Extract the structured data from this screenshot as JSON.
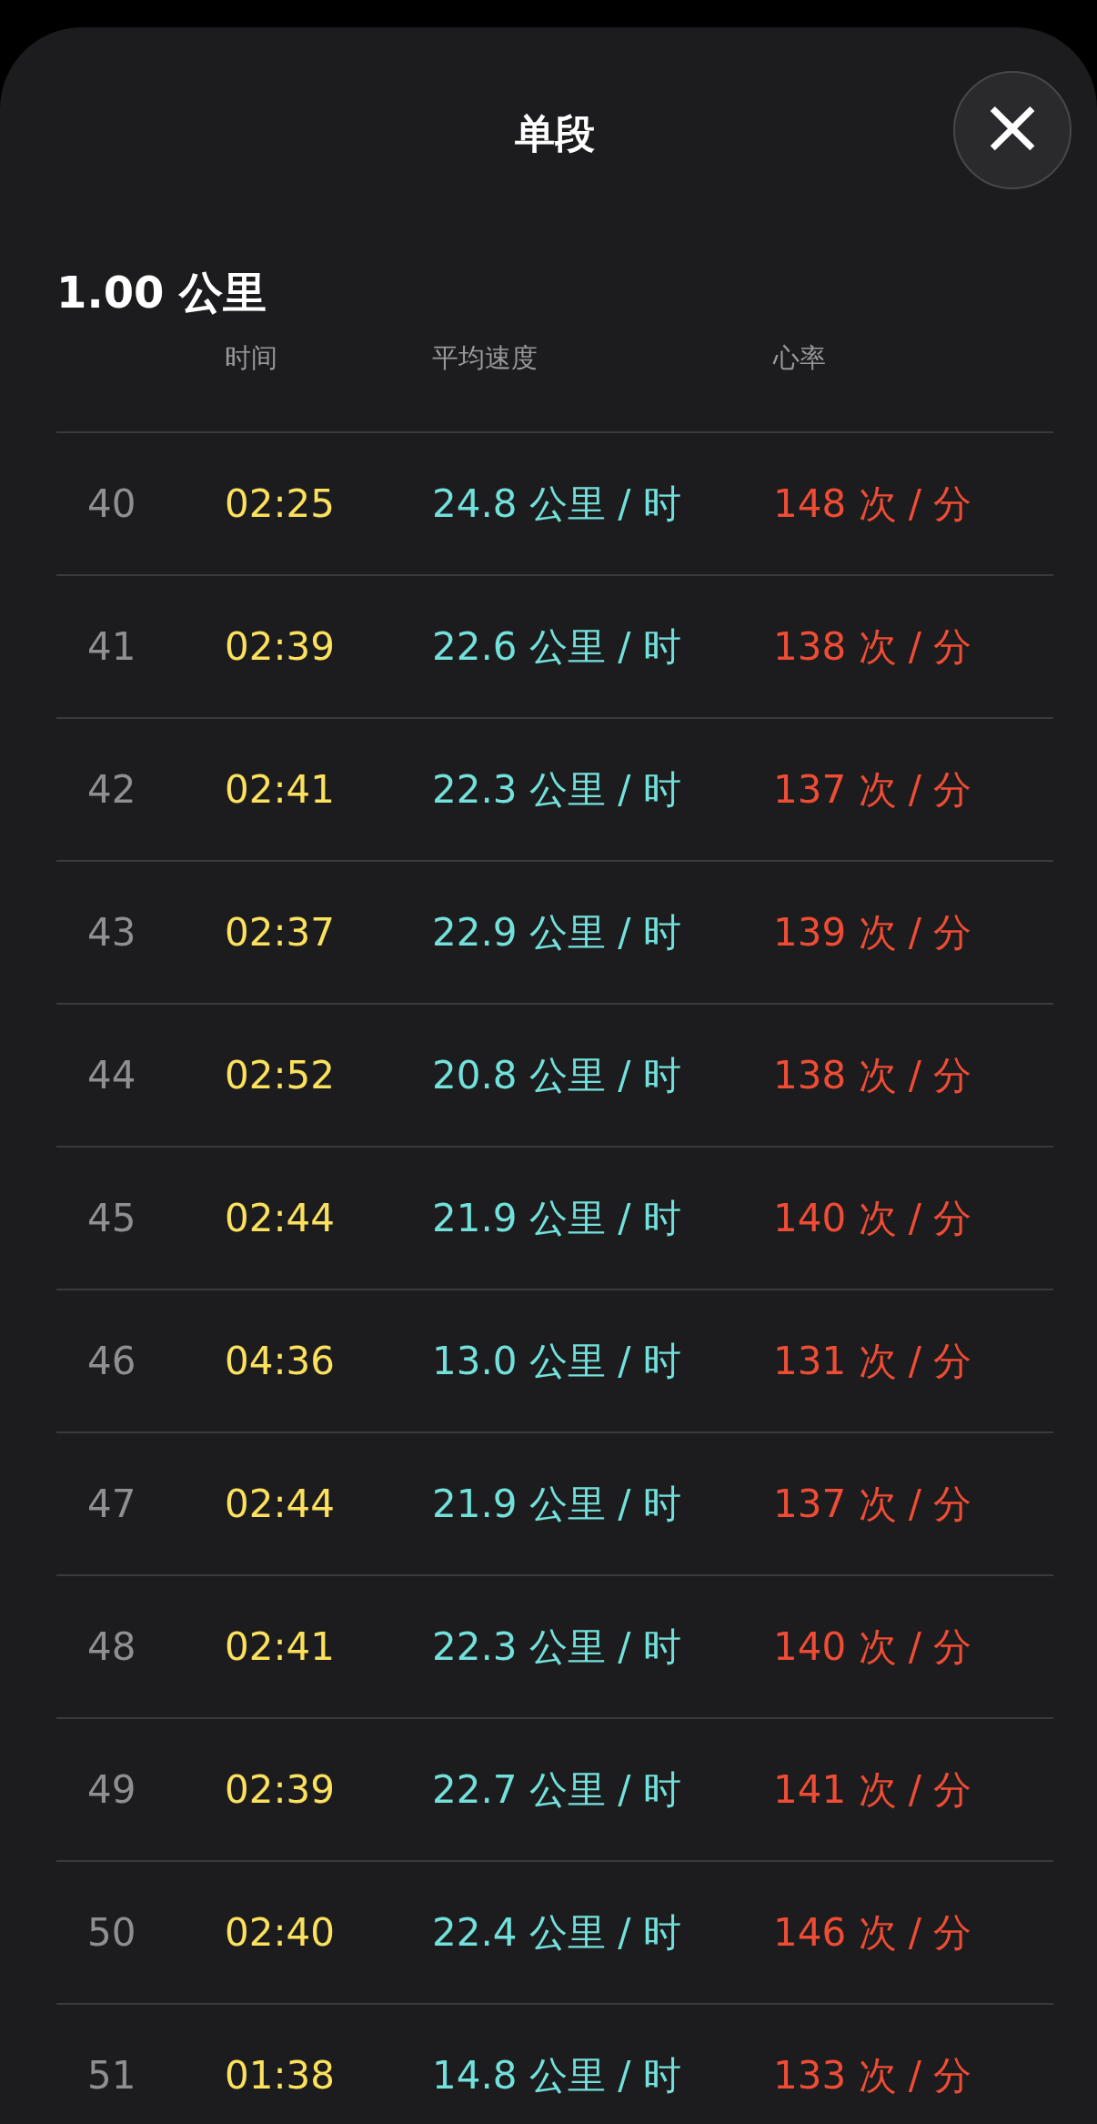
{
  "sheet": {
    "title": "单段",
    "close_button": {
      "label": "×"
    }
  },
  "split_distance": "1.00 公里",
  "table": {
    "columns": [
      "时间",
      "平均速度",
      "心率"
    ],
    "rows": [
      {
        "index": "40",
        "time": "02:25",
        "speed": "24.8 公里 / 时",
        "heart_rate": "148 次 / 分"
      },
      {
        "index": "41",
        "time": "02:39",
        "speed": "22.6 公里 / 时",
        "heart_rate": "138 次 / 分"
      },
      {
        "index": "42",
        "time": "02:41",
        "speed": "22.3 公里 / 时",
        "heart_rate": "137 次 / 分"
      },
      {
        "index": "43",
        "time": "02:37",
        "speed": "22.9 公里 / 时",
        "heart_rate": "139 次 / 分"
      },
      {
        "index": "44",
        "time": "02:52",
        "speed": "20.8 公里 / 时",
        "heart_rate": "138 次 / 分"
      },
      {
        "index": "45",
        "time": "02:44",
        "speed": "21.9 公里 / 时",
        "heart_rate": "140 次 / 分"
      },
      {
        "index": "46",
        "time": "04:36",
        "speed": "13.0 公里 / 时",
        "heart_rate": "131 次 / 分"
      },
      {
        "index": "47",
        "time": "02:44",
        "speed": "21.9 公里 / 时",
        "heart_rate": "137 次 / 分"
      },
      {
        "index": "48",
        "time": "02:41",
        "speed": "22.3 公里 / 时",
        "heart_rate": "140 次 / 分"
      },
      {
        "index": "49",
        "time": "02:39",
        "speed": "22.7 公里 / 时",
        "heart_rate": "141 次 / 分"
      },
      {
        "index": "50",
        "time": "02:40",
        "speed": "22.4 公里 / 时",
        "heart_rate": "146 次 / 分"
      },
      {
        "index": "51",
        "time": "01:38",
        "speed": "14.8 公里 / 时",
        "heart_rate": "133 次 / 分"
      }
    ]
  }
}
